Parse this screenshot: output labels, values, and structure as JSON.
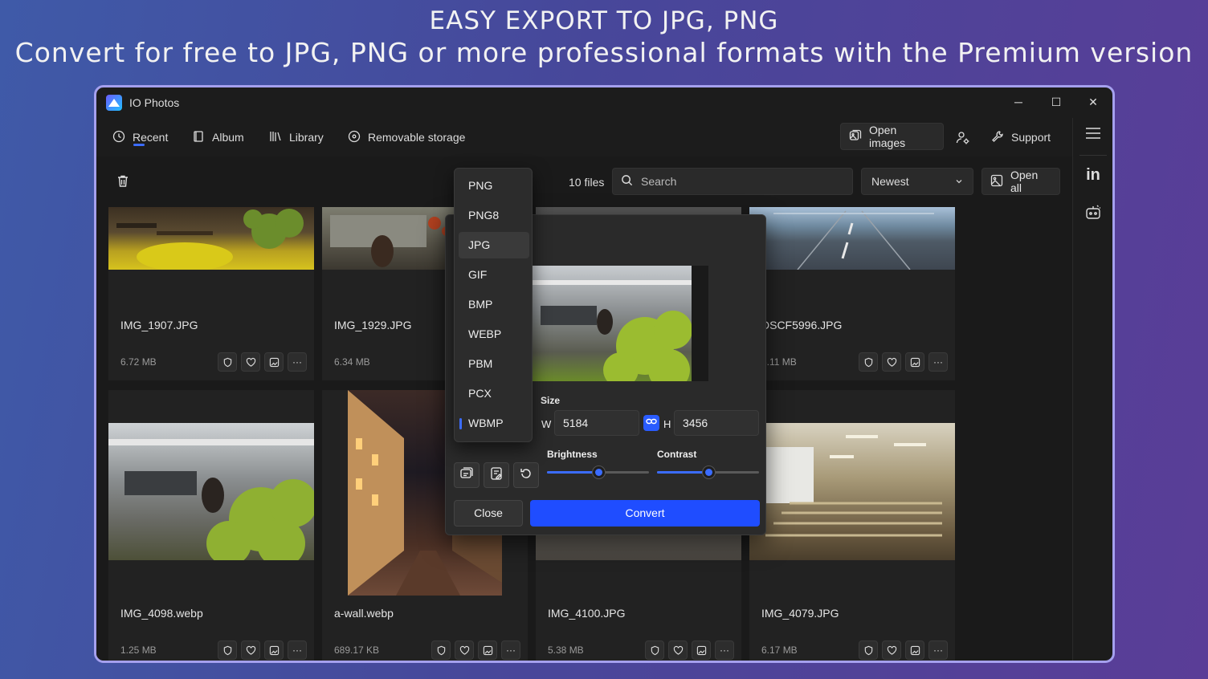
{
  "promo": {
    "headline": "EASY EXPORT TO JPG, PNG",
    "subheadline": "Convert for free to JPG, PNG or more professional formats with the Premium version"
  },
  "window": {
    "title": "IO Photos",
    "controls": {
      "minimize": "─",
      "maximize": "☐",
      "close": "✕"
    }
  },
  "nav": {
    "items": [
      {
        "label": "Recent",
        "icon": "clock-icon",
        "active": true
      },
      {
        "label": "Album",
        "icon": "album-icon"
      },
      {
        "label": "Library",
        "icon": "library-icon"
      },
      {
        "label": "Removable storage",
        "icon": "disc-icon"
      }
    ],
    "open_images": "Open images",
    "support": "Support"
  },
  "toolbar": {
    "files_count": "10 files",
    "search_placeholder": "Search",
    "sort_value": "Newest",
    "open_all": "Open all"
  },
  "gallery": [
    {
      "name": "IMG_1907.JPG",
      "size": "6.72 MB"
    },
    {
      "name": "IMG_1929.JPG",
      "size": "6.34 MB"
    },
    {
      "name": "",
      "size": ""
    },
    {
      "name": "DSCF5996.JPG",
      "size": "6.11 MB"
    },
    {
      "name": "IMG_4098.webp",
      "size": "1.25 MB"
    },
    {
      "name": "a-wall.webp",
      "size": "689.17 KB"
    },
    {
      "name": "IMG_4100.JPG",
      "size": "5.38 MB"
    },
    {
      "name": "IMG_4079.JPG",
      "size": "6.17 MB"
    }
  ],
  "card_actions": {
    "more": "···"
  },
  "formats": [
    "PNG",
    "PNG8",
    "JPG",
    "GIF",
    "BMP",
    "WEBP",
    "PBM",
    "PCX",
    "WBMP"
  ],
  "selected_format": "JPG",
  "current_format": "WBMP",
  "convert_dialog": {
    "size_label": "Size",
    "width_label": "W",
    "width_value": "5184",
    "height_label": "H",
    "height_value": "3456",
    "brightness_label": "Brightness",
    "brightness_level": 0.5,
    "contrast_label": "Contrast",
    "contrast_level": 0.5,
    "close_label": "Close",
    "convert_label": "Convert"
  }
}
